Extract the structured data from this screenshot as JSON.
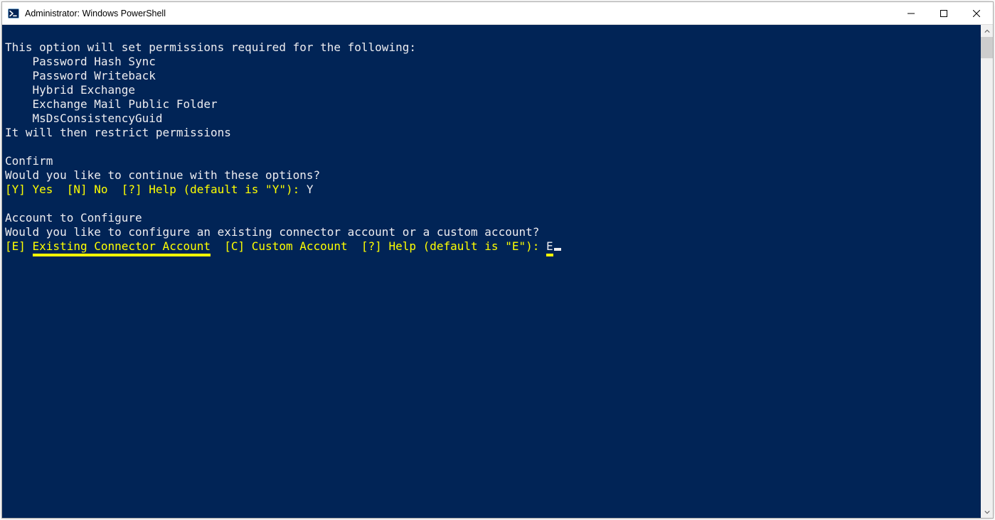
{
  "window": {
    "title": "Administrator: Windows PowerShell"
  },
  "console": {
    "line_blank_top": "",
    "line1": "This option will set permissions required for the following:",
    "line2": "    Password Hash Sync",
    "line3": "    Password Writeback",
    "line4": "    Hybrid Exchange",
    "line5": "    Exchange Mail Public Folder",
    "line6": "    MsDsConsistencyGuid",
    "line7": "It will then restrict permissions",
    "line_blank1": "",
    "line8": "Confirm",
    "line9": "Would you like to continue with these options?",
    "prompt1_opt_y": "[Y] Yes",
    "prompt1_sep1": "  ",
    "prompt1_opt_n": "[N] No",
    "prompt1_sep2": "  ",
    "prompt1_opt_help": "[?] Help",
    "prompt1_default": " (default is \"Y\"): ",
    "prompt1_input": "Y",
    "line_blank2": "",
    "line10": "Account to Configure",
    "line11": "Would you like to configure an existing connector account or a custom account?",
    "prompt2_opt_e_bracket": "[E] ",
    "prompt2_opt_e_text": "Existing Connector Account",
    "prompt2_sep1": "  ",
    "prompt2_opt_c": "[C] Custom Account",
    "prompt2_sep2": "  ",
    "prompt2_opt_help": "[?] Help",
    "prompt2_default": " (default is \"E\"): ",
    "prompt2_input": "E"
  }
}
